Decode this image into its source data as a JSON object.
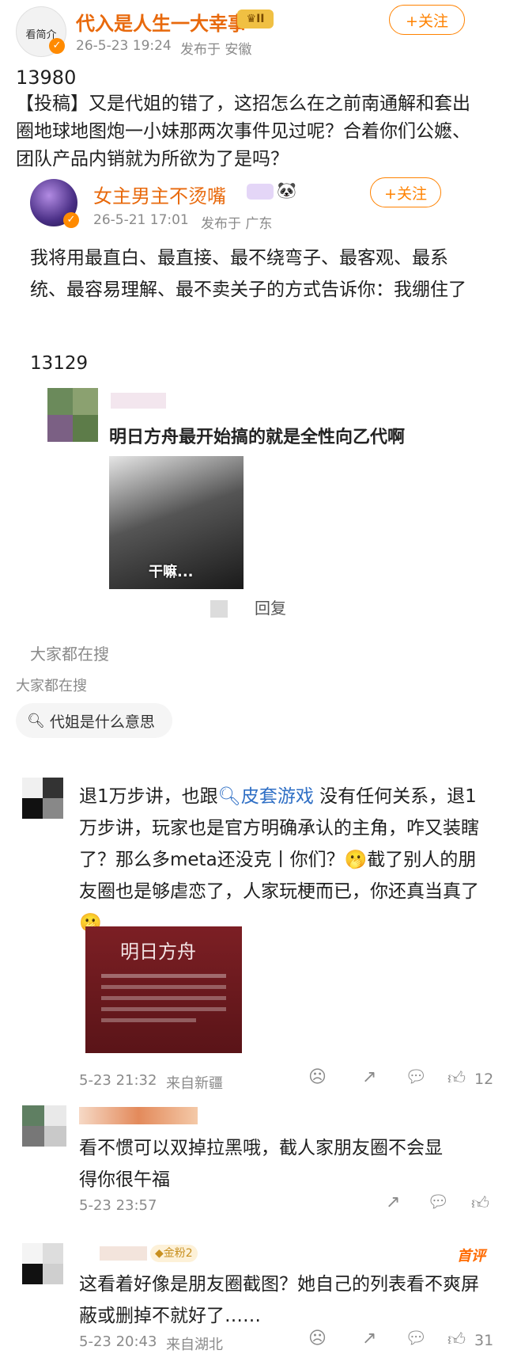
{
  "post": {
    "avatar_label": "看简介",
    "author": "代入是人生一大幸事",
    "badge": "II",
    "follow_label": "+关注",
    "time": "26-5-23 19:24",
    "location": "发布于 安徽",
    "number": "13980",
    "text": "【投稿】又是代姐的错了，这招怎么在之前南通解和套出圈地球地图炮一小妹那两次事件见过呢？合着你们公嬷、团队产品内销就为所欲为了是吗？"
  },
  "repost": {
    "author": "女主男主不烫嘴",
    "follow_label": "+关注",
    "time": "26-5-21 17:01",
    "location": "发布于 广东",
    "text": "我将用最直白、最直接、最不绕弯子、最客观、最系统、最容易理解、最不卖关子的方式告诉你：我绷住了",
    "number": "13129",
    "quote_text": "明日方舟最开始搞的就是全性向乙代啊",
    "meme_caption": "干嘛...",
    "reply_label": "回复",
    "search_label": "大家都在搜"
  },
  "search": {
    "label": "大家都在搜",
    "chip": "代姐是什么意思"
  },
  "comments": [
    {
      "text_before": "退1万步讲，也跟",
      "link": "皮套游戏",
      "text_after": "没有任何关系，退1万步讲，玩家也是官方明确承认的主角，咋又装瞎了？那么多meta还没克丨你们？🫢截了别人的朋友圈也是够虐恋了，人家玩梗而已，你还真当真了🫢",
      "image_title": "明日方舟",
      "time": "5-23 21:32",
      "location": "来自新疆",
      "likes": "12"
    },
    {
      "text": "看不惯可以双掉拉黑哦，截人家朋友圈不会显得你很午福",
      "time": "5-23 23:57",
      "location": "",
      "likes": ""
    },
    {
      "fan_badge": "金粉2",
      "top_label": "首评",
      "text": "这看着好像是朋友圈截图？她自己的列表看不爽屏蔽或删掉不就好了……",
      "time": "5-23 20:43",
      "location": "来自湖北",
      "likes": "31"
    }
  ],
  "colors": {
    "accent": "#ff8200",
    "name": "#e8690c",
    "link": "#2f6fc5"
  }
}
